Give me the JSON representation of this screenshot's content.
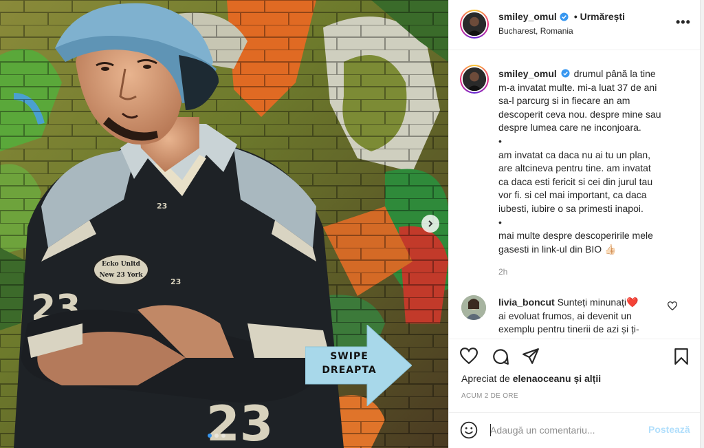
{
  "header": {
    "username": "smiley_omul",
    "follow_status": "• Urmărești",
    "location": "Bucharest, Romania",
    "more_label": "•••"
  },
  "caption": {
    "username": "smiley_omul",
    "lines": [
      "drumul până la tine",
      "m-a invatat multe. mi-a luat 37 de ani",
      "sa-l parcurg si in fiecare an am",
      "descoperit ceva nou. despre mine sau",
      "despre lumea care ne inconjoara.",
      "•",
      "am invatat ca daca nu ai tu un plan,",
      "are altcineva pentru tine. am invatat",
      "ca daca esti fericit si cei din jurul tau",
      "vor fi. si cel mai important, ca daca",
      "iubesti, iubire o sa primesti inapoi.",
      "•",
      "mai multe despre descoperirile mele",
      "gasesti in link-ul din BIO 👍🏻"
    ],
    "time": "2h"
  },
  "comment": {
    "username": "livia_boncut",
    "lines": [
      "Sunteți minunați❤️",
      "ai evoluat frumos, ai devenit un",
      "exemplu pentru tinerii de azi și ți-"
    ]
  },
  "likes": {
    "prefix": "Apreciat de",
    "user": "elenaoceanu",
    "suffix": "și alții"
  },
  "posted_time": "ACUM 2 DE ORE",
  "add_comment": {
    "placeholder": "Adaugă un comentariu...",
    "post_label": "Postează"
  },
  "media": {
    "overlay_line1": "SWIPE",
    "overlay_line2": "DREAPTA",
    "jersey_number": "23",
    "patch_line1": "Ecko Unltd",
    "patch_line2": "New 23 York",
    "carousel_count": 3,
    "carousel_active": 0
  },
  "colors": {
    "verified": "#3897f0",
    "post_disabled": "#b2dffc",
    "arrow_fill": "#a8d8ea"
  },
  "icons": [
    "heart-icon",
    "comment-icon",
    "share-icon",
    "bookmark-icon",
    "emoji-icon",
    "verified-icon",
    "chevron-right-icon"
  ]
}
